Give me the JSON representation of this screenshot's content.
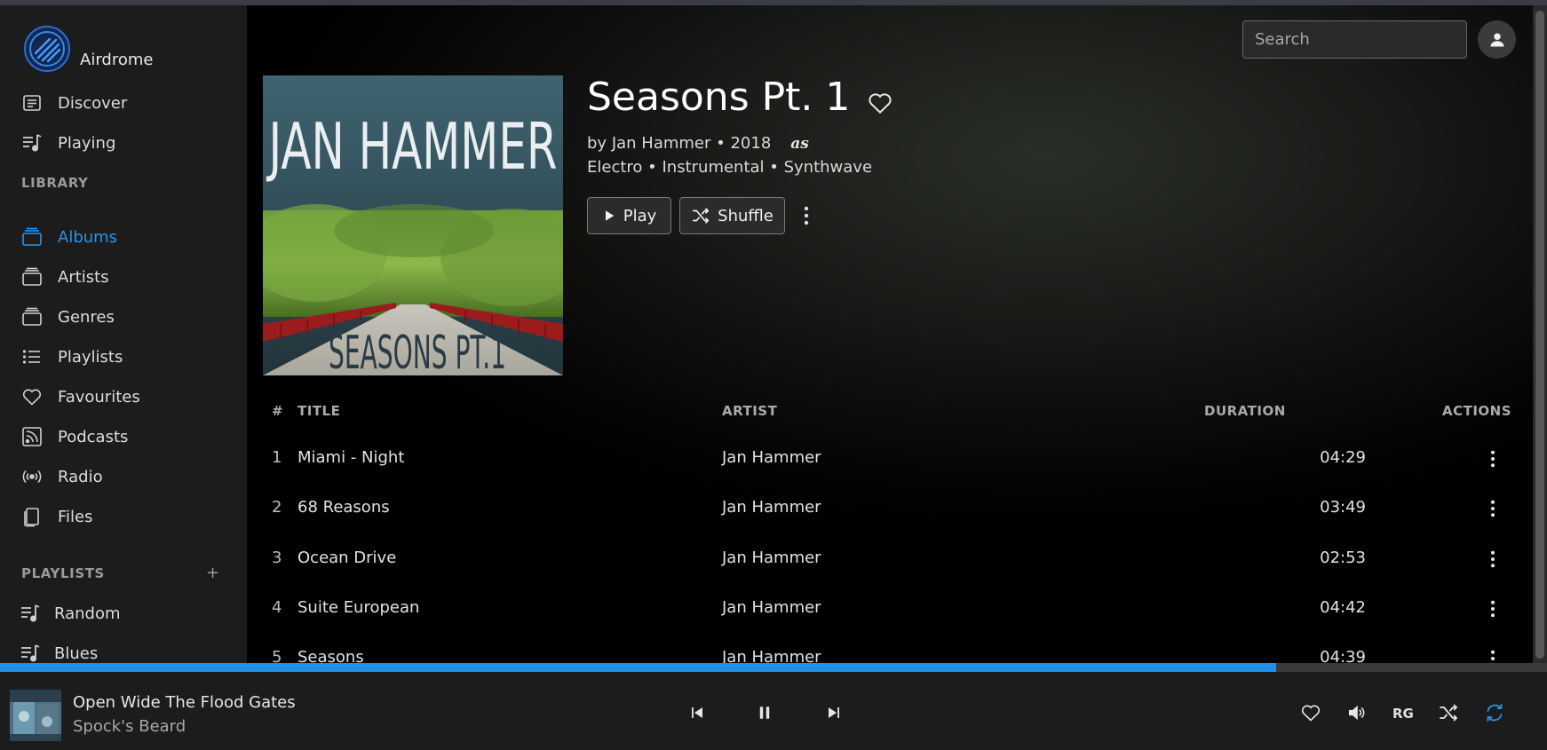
{
  "app": {
    "name": "Airdrome"
  },
  "nav": {
    "main": [
      {
        "label": "Discover",
        "icon": "discover-icon"
      },
      {
        "label": "Playing",
        "icon": "playing-icon"
      }
    ],
    "library_heading": "LIBRARY",
    "library": [
      {
        "label": "Albums",
        "icon": "albums-icon",
        "active": true
      },
      {
        "label": "Artists",
        "icon": "artists-icon"
      },
      {
        "label": "Genres",
        "icon": "genres-icon"
      },
      {
        "label": "Playlists",
        "icon": "playlists-icon"
      },
      {
        "label": "Favourites",
        "icon": "heart-icon"
      },
      {
        "label": "Podcasts",
        "icon": "podcast-icon"
      },
      {
        "label": "Radio",
        "icon": "radio-icon"
      },
      {
        "label": "Files",
        "icon": "files-icon"
      }
    ],
    "playlists_heading": "PLAYLISTS",
    "playlists_add": "+",
    "playlists": [
      {
        "label": "Random",
        "icon": "playlist-icon"
      },
      {
        "label": "Blues",
        "icon": "playlist-icon"
      }
    ]
  },
  "header": {
    "search_placeholder": "Search"
  },
  "album": {
    "title": "Seasons Pt. 1",
    "byline_prefix": "by",
    "artist": "Jan Hammer",
    "sep": "•",
    "year": "2018",
    "lastfm": "as",
    "genres": "Electro • Instrumental • Synthwave",
    "play_label": "Play",
    "shuffle_label": "Shuffle",
    "cover_text_top": "JAN HAMMER",
    "cover_text_bottom": "SEASONS PT.1"
  },
  "table": {
    "headers": {
      "num": "#",
      "title": "TITLE",
      "artist": "ARTIST",
      "duration": "DURATION",
      "actions": "ACTIONS"
    },
    "rows": [
      {
        "num": "1",
        "title": "Miami - Night",
        "artist": "Jan Hammer",
        "duration": "04:29"
      },
      {
        "num": "2",
        "title": "68 Reasons",
        "artist": "Jan Hammer",
        "duration": "03:49"
      },
      {
        "num": "3",
        "title": "Ocean Drive",
        "artist": "Jan Hammer",
        "duration": "02:53"
      },
      {
        "num": "4",
        "title": "Suite European",
        "artist": "Jan Hammer",
        "duration": "04:42"
      },
      {
        "num": "5",
        "title": "Seasons",
        "artist": "Jan Hammer",
        "duration": "04:39"
      }
    ]
  },
  "player": {
    "title": "Open Wide The Flood Gates",
    "artist": "Spock's Beard",
    "progress_fraction": 0.825,
    "rg_label": "RG",
    "accent": "#1e90e8"
  }
}
